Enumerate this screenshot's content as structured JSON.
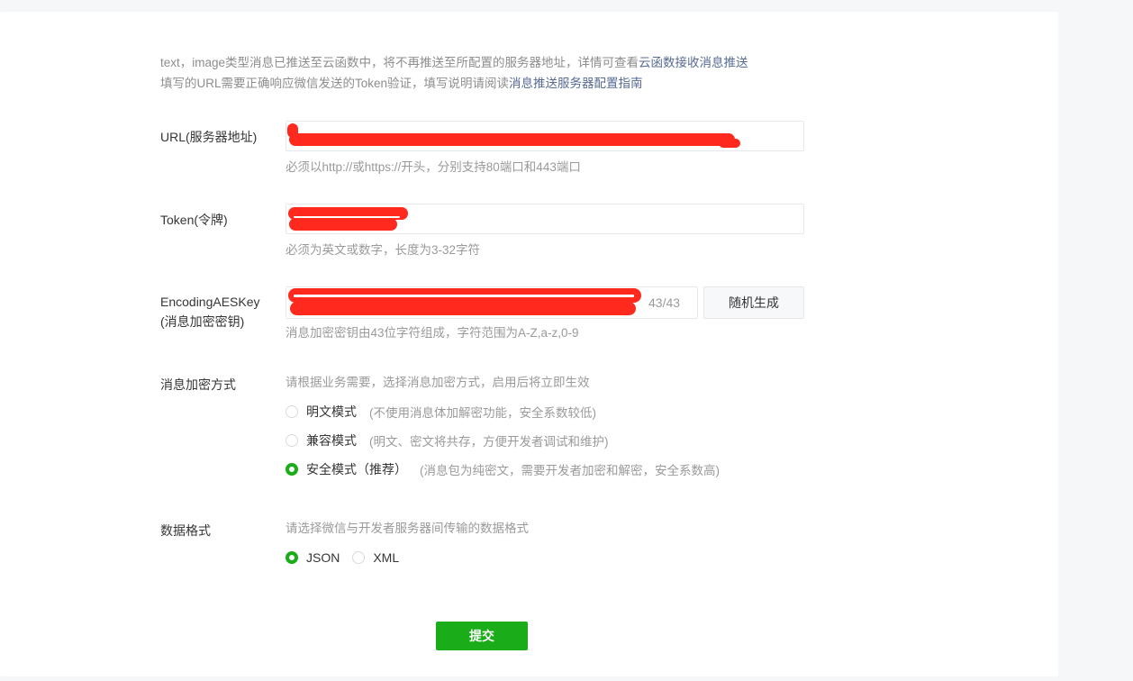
{
  "notice": {
    "line1_text": "text，image类型消息已推送至云函数中，将不再推送至所配置的服务器地址，详情可查看",
    "line1_link": "云函数接收消息推送",
    "line2_text": "填写的URL需要正确响应微信发送的Token验证，填写说明请阅读",
    "line2_link": "消息推送服务器配置指南"
  },
  "url": {
    "label": "URL(服务器地址)",
    "hint": "必须以http://或https://开头，分别支持80端口和443端口"
  },
  "token": {
    "label": "Token(令牌)",
    "hint": "必须为英文或数字，长度为3-32字符"
  },
  "aeskey": {
    "label_line1": "EncodingAESKey",
    "label_line2": "(消息加密密钥)",
    "counter": "43/43",
    "generate_label": "随机生成",
    "hint": "消息加密密钥由43位字符组成，字符范围为A-Z,a-z,0-9"
  },
  "encryption": {
    "label": "消息加密方式",
    "hint": "请根据业务需要，选择消息加密方式，启用后将立即生效",
    "options": [
      {
        "label": "明文模式",
        "desc": "(不使用消息体加解密功能，安全系数较低)",
        "checked": false
      },
      {
        "label": "兼容模式",
        "desc": "(明文、密文将共存，方便开发者调试和维护)",
        "checked": false
      },
      {
        "label": "安全模式（推荐）",
        "desc": "(消息包为纯密文，需要开发者加密和解密，安全系数高)",
        "checked": true
      }
    ]
  },
  "format": {
    "label": "数据格式",
    "hint": "请选择微信与开发者服务器间传输的数据格式",
    "options": [
      {
        "label": "JSON",
        "checked": true
      },
      {
        "label": "XML",
        "checked": false
      }
    ]
  },
  "submit_label": "提交",
  "colors": {
    "accent": "#1aad19",
    "link": "#576b95",
    "redaction": "#ff2a1d"
  }
}
